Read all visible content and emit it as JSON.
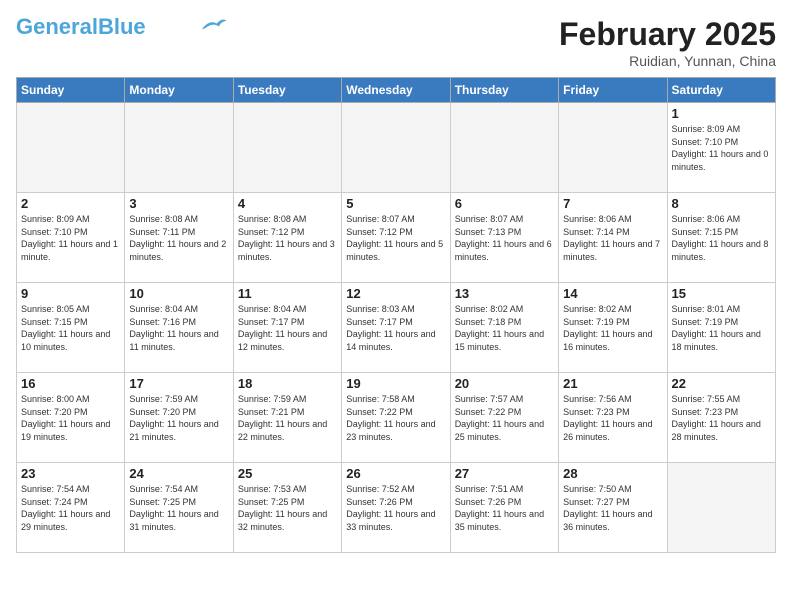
{
  "header": {
    "logo_general": "General",
    "logo_blue": "Blue",
    "month": "February 2025",
    "location": "Ruidian, Yunnan, China"
  },
  "days_of_week": [
    "Sunday",
    "Monday",
    "Tuesday",
    "Wednesday",
    "Thursday",
    "Friday",
    "Saturday"
  ],
  "weeks": [
    [
      {
        "day": "",
        "sunrise": "",
        "sunset": "",
        "daylight": ""
      },
      {
        "day": "",
        "sunrise": "",
        "sunset": "",
        "daylight": ""
      },
      {
        "day": "",
        "sunrise": "",
        "sunset": "",
        "daylight": ""
      },
      {
        "day": "",
        "sunrise": "",
        "sunset": "",
        "daylight": ""
      },
      {
        "day": "",
        "sunrise": "",
        "sunset": "",
        "daylight": ""
      },
      {
        "day": "",
        "sunrise": "",
        "sunset": "",
        "daylight": ""
      },
      {
        "day": "1",
        "sunrise": "8:09 AM",
        "sunset": "7:10 PM",
        "daylight": "11 hours and 0 minutes."
      }
    ],
    [
      {
        "day": "2",
        "sunrise": "8:09 AM",
        "sunset": "7:10 PM",
        "daylight": "11 hours and 1 minute."
      },
      {
        "day": "3",
        "sunrise": "8:08 AM",
        "sunset": "7:11 PM",
        "daylight": "11 hours and 2 minutes."
      },
      {
        "day": "4",
        "sunrise": "8:08 AM",
        "sunset": "7:12 PM",
        "daylight": "11 hours and 3 minutes."
      },
      {
        "day": "5",
        "sunrise": "8:07 AM",
        "sunset": "7:12 PM",
        "daylight": "11 hours and 5 minutes."
      },
      {
        "day": "6",
        "sunrise": "8:07 AM",
        "sunset": "7:13 PM",
        "daylight": "11 hours and 6 minutes."
      },
      {
        "day": "7",
        "sunrise": "8:06 AM",
        "sunset": "7:14 PM",
        "daylight": "11 hours and 7 minutes."
      },
      {
        "day": "8",
        "sunrise": "8:06 AM",
        "sunset": "7:15 PM",
        "daylight": "11 hours and 8 minutes."
      }
    ],
    [
      {
        "day": "9",
        "sunrise": "8:05 AM",
        "sunset": "7:15 PM",
        "daylight": "11 hours and 10 minutes."
      },
      {
        "day": "10",
        "sunrise": "8:04 AM",
        "sunset": "7:16 PM",
        "daylight": "11 hours and 11 minutes."
      },
      {
        "day": "11",
        "sunrise": "8:04 AM",
        "sunset": "7:17 PM",
        "daylight": "11 hours and 12 minutes."
      },
      {
        "day": "12",
        "sunrise": "8:03 AM",
        "sunset": "7:17 PM",
        "daylight": "11 hours and 14 minutes."
      },
      {
        "day": "13",
        "sunrise": "8:02 AM",
        "sunset": "7:18 PM",
        "daylight": "11 hours and 15 minutes."
      },
      {
        "day": "14",
        "sunrise": "8:02 AM",
        "sunset": "7:19 PM",
        "daylight": "11 hours and 16 minutes."
      },
      {
        "day": "15",
        "sunrise": "8:01 AM",
        "sunset": "7:19 PM",
        "daylight": "11 hours and 18 minutes."
      }
    ],
    [
      {
        "day": "16",
        "sunrise": "8:00 AM",
        "sunset": "7:20 PM",
        "daylight": "11 hours and 19 minutes."
      },
      {
        "day": "17",
        "sunrise": "7:59 AM",
        "sunset": "7:20 PM",
        "daylight": "11 hours and 21 minutes."
      },
      {
        "day": "18",
        "sunrise": "7:59 AM",
        "sunset": "7:21 PM",
        "daylight": "11 hours and 22 minutes."
      },
      {
        "day": "19",
        "sunrise": "7:58 AM",
        "sunset": "7:22 PM",
        "daylight": "11 hours and 23 minutes."
      },
      {
        "day": "20",
        "sunrise": "7:57 AM",
        "sunset": "7:22 PM",
        "daylight": "11 hours and 25 minutes."
      },
      {
        "day": "21",
        "sunrise": "7:56 AM",
        "sunset": "7:23 PM",
        "daylight": "11 hours and 26 minutes."
      },
      {
        "day": "22",
        "sunrise": "7:55 AM",
        "sunset": "7:23 PM",
        "daylight": "11 hours and 28 minutes."
      }
    ],
    [
      {
        "day": "23",
        "sunrise": "7:54 AM",
        "sunset": "7:24 PM",
        "daylight": "11 hours and 29 minutes."
      },
      {
        "day": "24",
        "sunrise": "7:54 AM",
        "sunset": "7:25 PM",
        "daylight": "11 hours and 31 minutes."
      },
      {
        "day": "25",
        "sunrise": "7:53 AM",
        "sunset": "7:25 PM",
        "daylight": "11 hours and 32 minutes."
      },
      {
        "day": "26",
        "sunrise": "7:52 AM",
        "sunset": "7:26 PM",
        "daylight": "11 hours and 33 minutes."
      },
      {
        "day": "27",
        "sunrise": "7:51 AM",
        "sunset": "7:26 PM",
        "daylight": "11 hours and 35 minutes."
      },
      {
        "day": "28",
        "sunrise": "7:50 AM",
        "sunset": "7:27 PM",
        "daylight": "11 hours and 36 minutes."
      },
      {
        "day": "",
        "sunrise": "",
        "sunset": "",
        "daylight": ""
      }
    ]
  ]
}
